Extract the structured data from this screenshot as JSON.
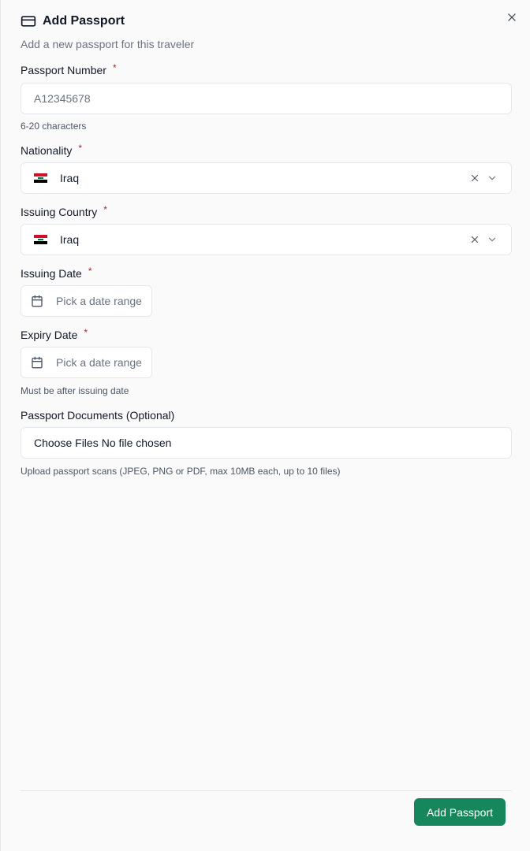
{
  "dialog": {
    "title": "Add Passport",
    "subtitle": "Add a new passport for this traveler",
    "icons": {
      "header": "credit-card-icon",
      "close": "close-icon"
    }
  },
  "passport_number": {
    "label": "Passport Number",
    "required_mark": "*",
    "placeholder": "A12345678",
    "value": "",
    "help": "6-20 characters"
  },
  "nationality": {
    "label": "Nationality",
    "required_mark": "*",
    "value": "Iraq",
    "flag": "iraq-flag-icon"
  },
  "issuing_country": {
    "label": "Issuing Country",
    "required_mark": "*",
    "value": "Iraq",
    "flag": "iraq-flag-icon"
  },
  "issuing_date": {
    "label": "Issuing Date",
    "required_mark": "*",
    "placeholder": "Pick a date range"
  },
  "expiry_date": {
    "label": "Expiry Date",
    "required_mark": "*",
    "placeholder": "Pick a date range",
    "help": "Must be after issuing date"
  },
  "documents": {
    "label": "Passport Documents (Optional)",
    "choose_label": "Choose Files",
    "status": "No file chosen",
    "help": "Upload passport scans (JPEG, PNG or PDF, max 10MB each, up to 10 files)"
  },
  "footer": {
    "submit_label": "Add Passport"
  },
  "colors": {
    "primary": "#16875c",
    "required": "#b91c1c",
    "border": "#e5e7eb"
  }
}
